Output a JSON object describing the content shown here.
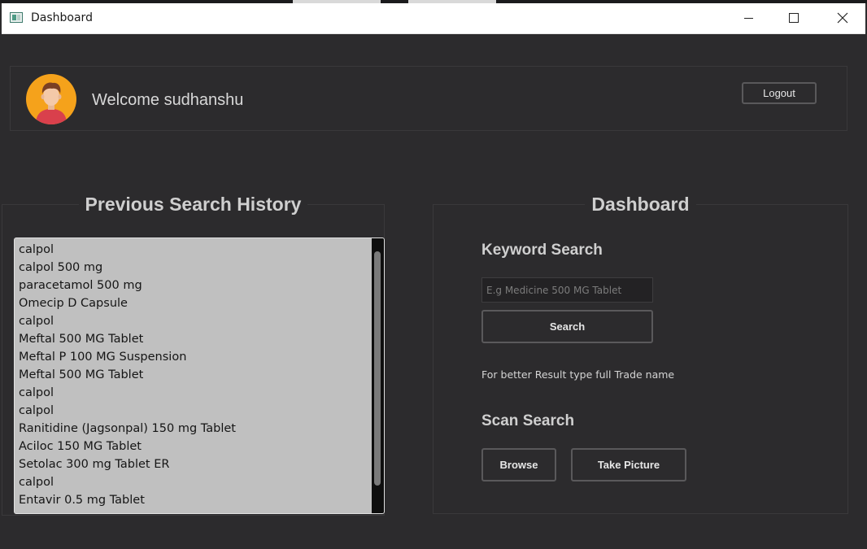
{
  "window": {
    "title": "Dashboard"
  },
  "header": {
    "welcome_prefix": "Welcome",
    "username": "sudhanshu",
    "logout_label": "Logout"
  },
  "history": {
    "title": "Previous Search History",
    "items": [
      "calpol",
      "calpol 500 mg",
      "paracetamol 500 mg",
      "Omecip D Capsule",
      "calpol",
      "Meftal 500 MG Tablet",
      "Meftal P 100 MG Suspension",
      "Meftal 500 MG Tablet",
      "calpol",
      "calpol",
      "Ranitidine (Jagsonpal) 150 mg Tablet",
      "Aciloc 150 MG Tablet",
      "Setolac 300 mg Tablet ER",
      "calpol",
      "Entavir 0.5 mg Tablet"
    ]
  },
  "dashboard": {
    "title": "Dashboard",
    "keyword_heading": "Keyword Search",
    "search_placeholder": "E.g Medicine 500 MG Tablet",
    "search_value": "",
    "search_label": "Search",
    "hint": "For better Result type full Trade name",
    "scan_heading": "Scan Search",
    "browse_label": "Browse",
    "take_picture_label": "Take Picture"
  },
  "colors": {
    "background": "#2c2b2d",
    "list_background": "#c0c0c0",
    "avatar_circle": "#f5a21b",
    "button_border": "#5a595b"
  },
  "icons": {
    "app": "app-window-icon",
    "minimize": "minimize-icon",
    "maximize": "maximize-icon",
    "close": "close-icon",
    "avatar": "user-avatar-icon"
  }
}
